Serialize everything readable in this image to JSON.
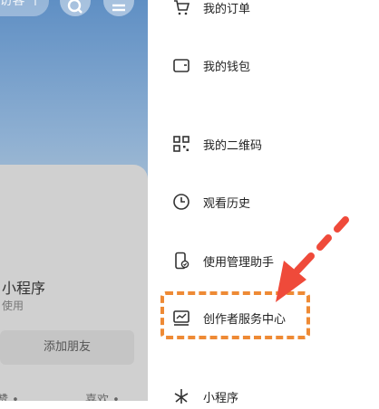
{
  "left_panel": {
    "top_button_label": "友访客 丨",
    "mini_program_title": "小程序",
    "mini_program_sub": "使用",
    "add_friend_label": "添加朋友",
    "bottom_left_label": "赞 •",
    "bottom_right_label": "喜欢 •"
  },
  "menu": {
    "items": [
      {
        "label": "我的订单",
        "icon": "cart-icon"
      },
      {
        "label": "我的钱包",
        "icon": "wallet-icon"
      },
      {
        "label": "我的二维码",
        "icon": "qr-code-icon"
      },
      {
        "label": "观看历史",
        "icon": "clock-icon"
      },
      {
        "label": "使用管理助手",
        "icon": "phone-manage-icon"
      },
      {
        "label": "创作者服务中心",
        "icon": "creator-center-icon"
      },
      {
        "label": "小程序",
        "icon": "mini-program-icon"
      }
    ]
  },
  "annotation": {
    "highlight_color": "#ee8a35",
    "arrow_color": "#ef4a3a"
  }
}
